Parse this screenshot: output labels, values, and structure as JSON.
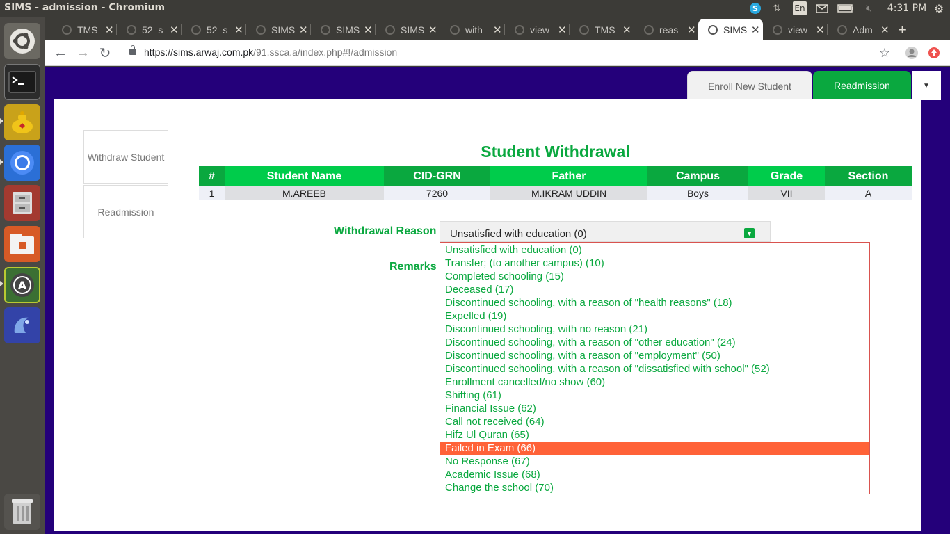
{
  "os": {
    "window_title": "SIMS - admission - Chromium",
    "keyboard": "En",
    "clock": "4:31 PM"
  },
  "browser": {
    "tabs": [
      {
        "label": "TMS"
      },
      {
        "label": "52_s"
      },
      {
        "label": "52_s"
      },
      {
        "label": "SIMS"
      },
      {
        "label": "SIMS"
      },
      {
        "label": "SIMS"
      },
      {
        "label": "with"
      },
      {
        "label": "view"
      },
      {
        "label": "TMS"
      },
      {
        "label": "reas"
      },
      {
        "label": "SIMS",
        "active": true
      },
      {
        "label": "view"
      },
      {
        "label": "Adm"
      }
    ],
    "url_base": "https://sims.arwaj.com.pk",
    "url_path": "/91.ssca.a/index.php#!/admission"
  },
  "app": {
    "top_tabs": {
      "enroll": "Enroll New Student",
      "readmission": "Readmission"
    },
    "side_menu": {
      "withdraw": "Withdraw Student",
      "readmission": "Readmission"
    },
    "heading": "Student Withdrawal",
    "table": {
      "headers": [
        "#",
        "Student Name",
        "CID-GRN",
        "Father",
        "Campus",
        "Grade",
        "Section"
      ],
      "row": [
        "1",
        "M.AREEB",
        "7260",
        "M.IKRAM UDDIN",
        "Boys",
        "VII",
        "A"
      ]
    },
    "form": {
      "reason_label": "Withdrawal Reason",
      "remarks_label": "Remarks",
      "selected_reason": "Unsatisfied with education (0)"
    },
    "dropdown_options": [
      "Unsatisfied with education (0)",
      "Transfer; (to another campus) (10)",
      "Completed schooling (15)",
      "Deceased (17)",
      "Discontinued schooling, with a reason of \"health reasons\" (18)",
      "Expelled (19)",
      "Discontinued schooling, with no reason (21)",
      "Discontinued schooling, with a reason of \"other education\" (24)",
      "Discontinued schooling, with a reason of \"employment\" (50)",
      "Discontinued schooling, with a reason of \"dissatisfied with school\" (52)",
      "Enrollment cancelled/no show (60)",
      "Shifting (61)",
      "Financial Issue (62)",
      "Call not received (64)",
      "Hifz Ul Quran (65)",
      "Failed in Exam (66)",
      "No Response (67)",
      "Academic Issue (68)",
      "Change the school (70)"
    ],
    "highlighted_option": "Failed in Exam (66)"
  }
}
